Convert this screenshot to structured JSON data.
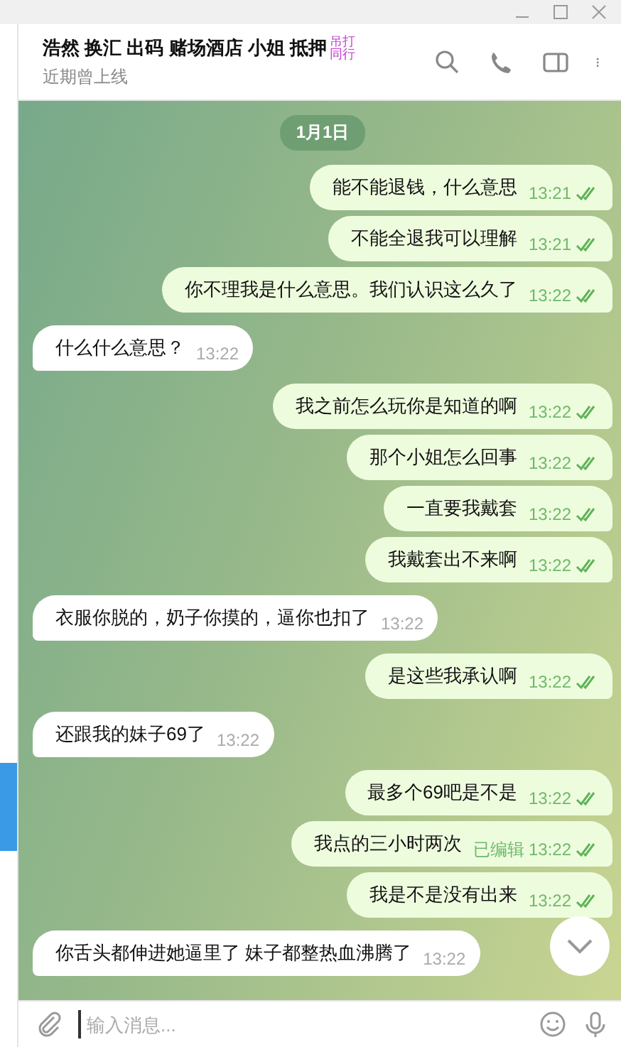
{
  "chat": {
    "title": "浩然 换汇 出码 赌场酒店 小姐 抵押",
    "title_badge": "吊打同行",
    "status": "近期曾上线"
  },
  "date": "1月1日",
  "messages": [
    {
      "kind": "out",
      "text": "能不能退钱，什么意思",
      "time": "13:21",
      "read": true
    },
    {
      "kind": "out",
      "text": "不能全退我可以理解",
      "time": "13:21",
      "read": true
    },
    {
      "kind": "out",
      "text": "你不理我是什么意思。我们认识这么久了",
      "time": "13:22",
      "read": true
    },
    {
      "kind": "in",
      "text": "什么什么意思？",
      "time": "13:22"
    },
    {
      "kind": "out",
      "text": "我之前怎么玩你是知道的啊",
      "time": "13:22",
      "read": true
    },
    {
      "kind": "out",
      "text": "那个小姐怎么回事",
      "time": "13:22",
      "read": true
    },
    {
      "kind": "out",
      "text": "一直要我戴套",
      "time": "13:22",
      "read": true
    },
    {
      "kind": "out",
      "text": "我戴套出不来啊",
      "time": "13:22",
      "read": true
    },
    {
      "kind": "in",
      "text": "衣服你脱的，奶子你摸的，逼你也扣了",
      "time": "13:22"
    },
    {
      "kind": "out",
      "text": "是这些我承认啊",
      "time": "13:22",
      "read": true
    },
    {
      "kind": "in",
      "text": "还跟我的妹子69了",
      "time": "13:22"
    },
    {
      "kind": "out",
      "text": "最多个69吧是不是",
      "time": "13:22",
      "read": true
    },
    {
      "kind": "out",
      "text": "我点的三小时两次",
      "time": "13:22",
      "read": true,
      "edited": "已编辑"
    },
    {
      "kind": "out",
      "text": "我是不是没有出来",
      "time": "13:22",
      "read": true
    },
    {
      "kind": "in",
      "text": "你舌头都伸进她逼里了 妹子都整热血沸腾了",
      "time": "13:22"
    }
  ],
  "composer": {
    "placeholder": "输入消息..."
  }
}
